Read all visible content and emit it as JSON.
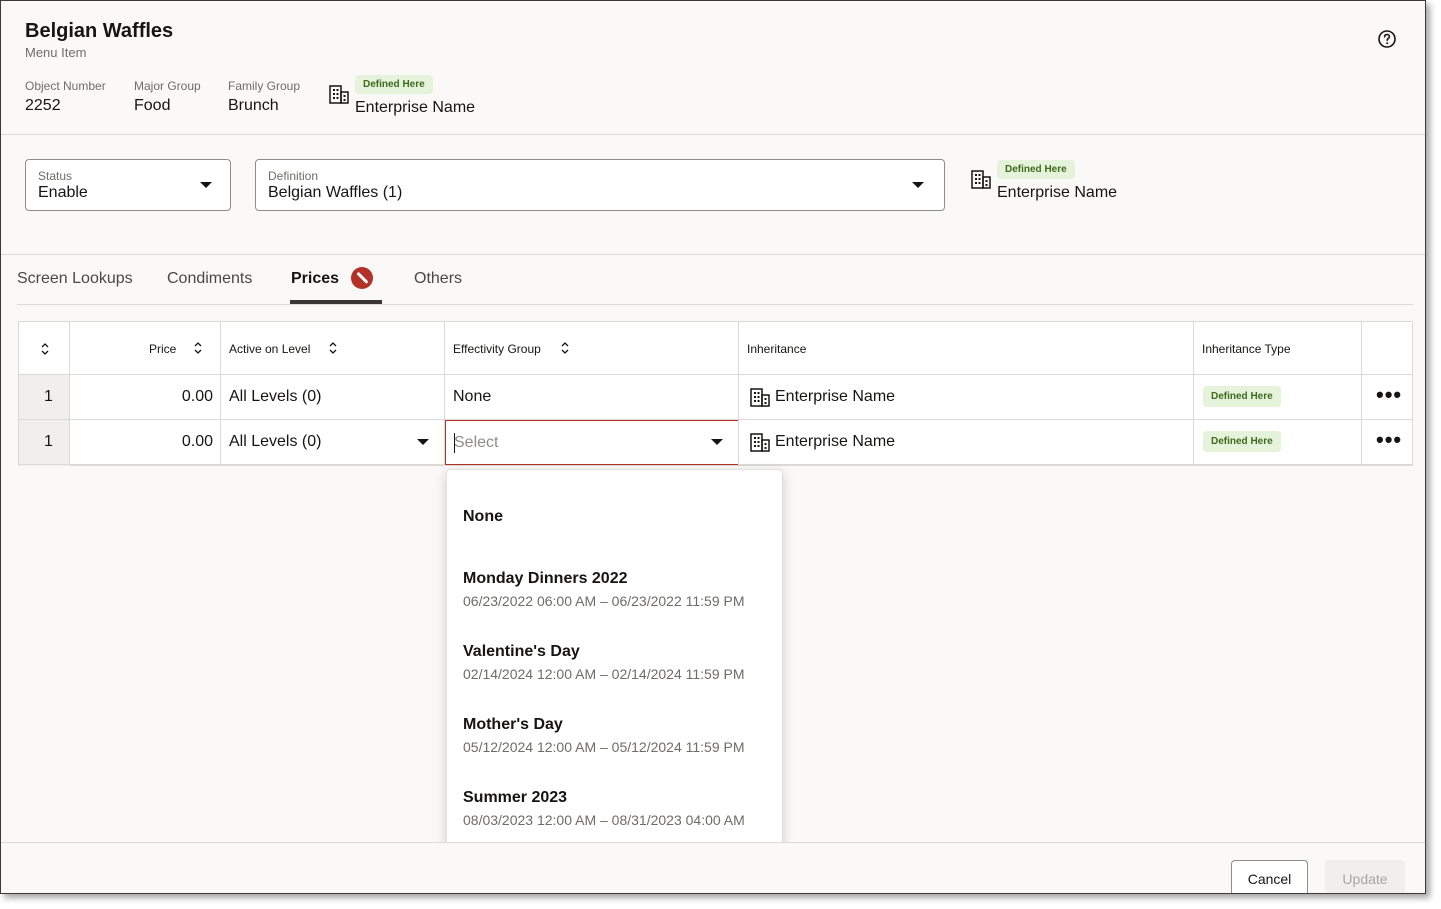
{
  "header": {
    "title": "Belgian Waffles",
    "subtitle": "Menu Item",
    "help_icon": "question-circle-icon",
    "object_number": {
      "label": "Object Number",
      "value": "2252"
    },
    "major_group": {
      "label": "Major Group",
      "value": "Food"
    },
    "family_group": {
      "label": "Family Group",
      "value": "Brunch"
    },
    "ownership": {
      "icon": "building-icon",
      "badge": "Defined Here",
      "name": "Enterprise Name"
    }
  },
  "form": {
    "status": {
      "label": "Status",
      "value": "Enable"
    },
    "definition": {
      "label": "Definition",
      "value": "Belgian Waffles (1)"
    },
    "ownership": {
      "icon": "building-icon",
      "badge": "Defined Here",
      "name": "Enterprise Name"
    }
  },
  "tabs": [
    {
      "label": "Screen Lookups",
      "active": false
    },
    {
      "label": "Condiments",
      "active": false
    },
    {
      "label": "Prices",
      "active": true,
      "error_icon": "error-circle-icon"
    },
    {
      "label": "Others",
      "active": false
    }
  ],
  "table": {
    "columns": [
      "Price",
      "Active on Level",
      "Effectivity Group",
      "Inheritance",
      "Inheritance Type"
    ],
    "rows": [
      {
        "seq": "1",
        "price": "0.00",
        "active_on_level": "All Levels (0)",
        "effectivity_group": "None",
        "inheritance": "Enterprise Name",
        "inheritance_type": "Defined Here",
        "actions": "•••"
      },
      {
        "seq": "1",
        "price": "0.00",
        "active_on_level": "All Levels (0)",
        "effectivity_group_placeholder": "Select",
        "inheritance": "Enterprise Name",
        "inheritance_type": "Defined Here",
        "actions": "•••"
      }
    ]
  },
  "dropdown": {
    "options": [
      {
        "name": "None",
        "dates": ""
      },
      {
        "name": "Monday Dinners 2022",
        "dates": "06/23/2022 06:00 AM – 06/23/2022 11:59 PM"
      },
      {
        "name": "Valentine's Day",
        "dates": "02/14/2024 12:00 AM – 02/14/2024 11:59 PM"
      },
      {
        "name": "Mother's Day",
        "dates": "05/12/2024 12:00 AM – 05/12/2024 11:59 PM"
      },
      {
        "name": "Summer 2023",
        "dates": "08/03/2023 12:00 AM – 08/31/2023 04:00 AM"
      }
    ]
  },
  "footer": {
    "cancel_label": "Cancel",
    "update_label": "Update"
  },
  "colors": {
    "badge_bg": "#e4f3d9",
    "badge_text": "#3f6a1e",
    "error": "#b33127",
    "tab_underline": "#3a3632"
  }
}
